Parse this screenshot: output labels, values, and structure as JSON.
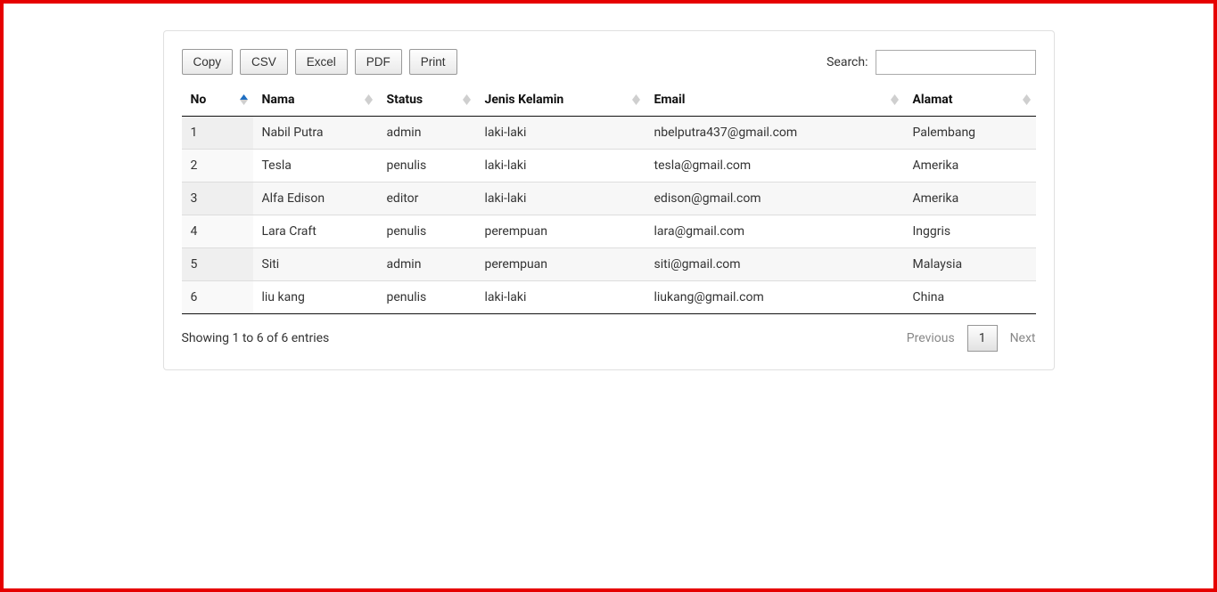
{
  "buttons": {
    "copy": "Copy",
    "csv": "CSV",
    "excel": "Excel",
    "pdf": "PDF",
    "print": "Print"
  },
  "search": {
    "label": "Search:",
    "value": ""
  },
  "columns": {
    "no": "No",
    "nama": "Nama",
    "status": "Status",
    "jenis_kelamin": "Jenis Kelamin",
    "email": "Email",
    "alamat": "Alamat"
  },
  "rows": [
    {
      "no": "1",
      "nama": "Nabil Putra",
      "status": "admin",
      "jenis_kelamin": "laki-laki",
      "email": "nbelputra437@gmail.com",
      "alamat": "Palembang"
    },
    {
      "no": "2",
      "nama": "Tesla",
      "status": "penulis",
      "jenis_kelamin": "laki-laki",
      "email": "tesla@gmail.com",
      "alamat": "Amerika"
    },
    {
      "no": "3",
      "nama": "Alfa Edison",
      "status": "editor",
      "jenis_kelamin": "laki-laki",
      "email": "edison@gmail.com",
      "alamat": "Amerika"
    },
    {
      "no": "4",
      "nama": "Lara Craft",
      "status": "penulis",
      "jenis_kelamin": "perempuan",
      "email": "lara@gmail.com",
      "alamat": "Inggris"
    },
    {
      "no": "5",
      "nama": "Siti",
      "status": "admin",
      "jenis_kelamin": "perempuan",
      "email": "siti@gmail.com",
      "alamat": "Malaysia"
    },
    {
      "no": "6",
      "nama": "liu kang",
      "status": "penulis",
      "jenis_kelamin": "laki-laki",
      "email": "liukang@gmail.com",
      "alamat": "China"
    }
  ],
  "info": "Showing 1 to 6 of 6 entries",
  "pagination": {
    "previous": "Previous",
    "next": "Next",
    "current_page": "1"
  }
}
